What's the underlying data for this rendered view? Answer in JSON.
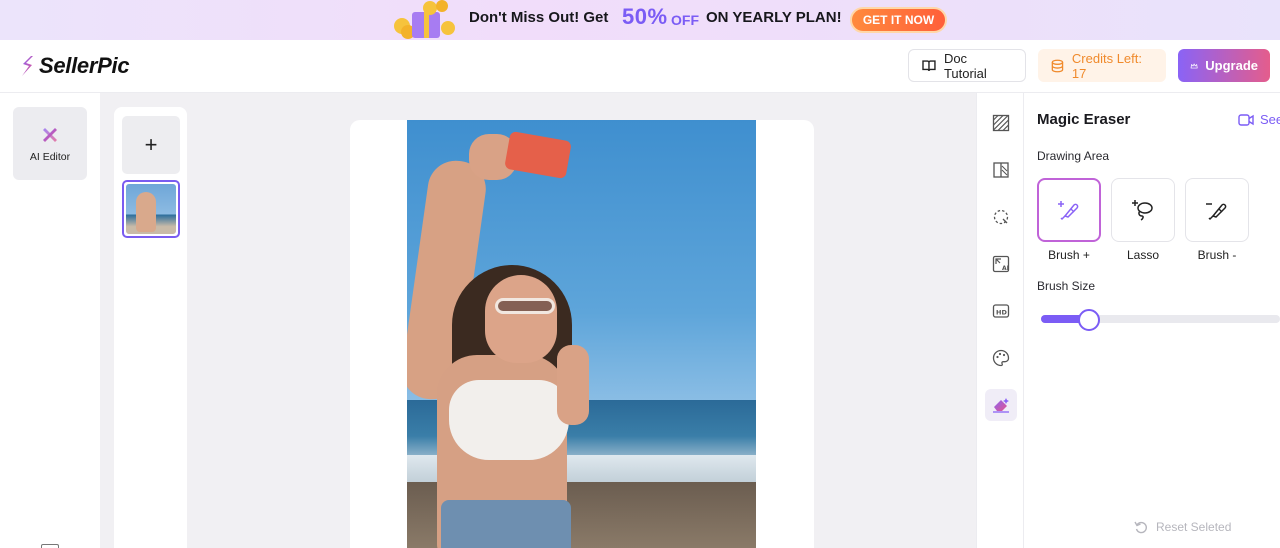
{
  "promo": {
    "text_before": "Don't Miss Out! Get",
    "percent": "50%",
    "off": "OFF",
    "text_after": "ON YEARLY PLAN!",
    "cta": "GET IT NOW"
  },
  "header": {
    "brand": "SellerPic",
    "doc_tutorial": "Doc Tutorial",
    "credits": "Credits Left: 17",
    "upgrade": "Upgrade"
  },
  "rail": {
    "items": [
      {
        "label": "AI Editor",
        "icon": "ai-editor-icon"
      }
    ]
  },
  "thumbnails": {
    "add_label": "+",
    "selected_index": 0
  },
  "tools": [
    {
      "icon": "texture-icon"
    },
    {
      "icon": "background-swap-icon"
    },
    {
      "icon": "lasso-circle-icon"
    },
    {
      "icon": "ai-expand-icon"
    },
    {
      "icon": "hd-icon"
    },
    {
      "icon": "palette-icon"
    },
    {
      "icon": "eraser-icon",
      "active": true
    }
  ],
  "panel": {
    "title": "Magic Eraser",
    "see_link": "See",
    "drawing_area_label": "Drawing Area",
    "modes": [
      {
        "label": "Brush +",
        "icon": "brush-plus-icon",
        "selected": true
      },
      {
        "label": "Lasso",
        "icon": "lasso-icon",
        "selected": false
      },
      {
        "label": "Brush -",
        "icon": "brush-minus-icon",
        "selected": false
      }
    ],
    "brush_size_label": "Brush Size",
    "brush_size_fraction": 0.2,
    "reset_label": "Reset Seleted"
  },
  "colors": {
    "accent": "#7b5cf5",
    "cta_orange": "#ff6a3a",
    "credits_orange": "#f08a2c"
  }
}
